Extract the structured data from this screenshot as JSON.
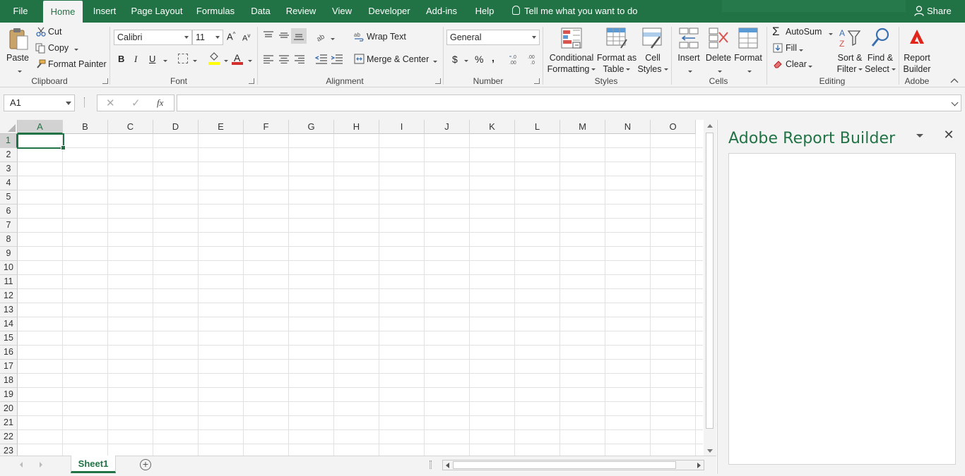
{
  "menu": {
    "tabs": [
      "File",
      "Home",
      "Insert",
      "Page Layout",
      "Formulas",
      "Data",
      "Review",
      "View",
      "Developer",
      "Add-ins",
      "Help"
    ],
    "tell_me": "Tell me what you want to do",
    "share": "Share"
  },
  "ribbon": {
    "clipboard": {
      "paste": "Paste",
      "cut": "Cut",
      "copy": "Copy",
      "format_painter": "Format Painter",
      "label": "Clipboard"
    },
    "font": {
      "name": "Calibri",
      "size": "11",
      "bold": "B",
      "italic": "I",
      "underline": "U",
      "label": "Font",
      "font_color": "#d32f2f",
      "highlight_color": "#ffff00"
    },
    "alignment": {
      "wrap_text": "Wrap Text",
      "merge_center": "Merge & Center",
      "label": "Alignment"
    },
    "number": {
      "format": "General",
      "currency": "$",
      "percent": "%",
      "comma": ",",
      "label": "Number"
    },
    "styles": {
      "conditional": [
        "Conditional",
        "Formatting"
      ],
      "format_table": [
        "Format as",
        "Table"
      ],
      "cell_styles": [
        "Cell",
        "Styles"
      ],
      "label": "Styles"
    },
    "cells": {
      "insert": "Insert",
      "delete": "Delete",
      "format": "Format",
      "label": "Cells"
    },
    "editing": {
      "autosum": "AutoSum",
      "fill": "Fill",
      "clear": "Clear",
      "sort_filter": [
        "Sort &",
        "Filter"
      ],
      "find_select": [
        "Find &",
        "Select"
      ],
      "label": "Editing"
    },
    "adobe": {
      "report_builder": [
        "Report",
        "Builder"
      ],
      "label": "Adobe"
    }
  },
  "formula_bar": {
    "name_box": "A1",
    "fx": "fx",
    "value": ""
  },
  "grid": {
    "columns": [
      "A",
      "B",
      "C",
      "D",
      "E",
      "F",
      "G",
      "H",
      "I",
      "J",
      "K",
      "L",
      "M",
      "N",
      "O"
    ],
    "rows": [
      "1",
      "2",
      "3",
      "4",
      "5",
      "6",
      "7",
      "8",
      "9",
      "10",
      "11",
      "12",
      "13",
      "14",
      "15",
      "16",
      "17",
      "18",
      "19",
      "20",
      "21",
      "22",
      "23"
    ],
    "active_column": "A",
    "active_row": "1"
  },
  "sheets": {
    "tabs": [
      "Sheet1"
    ],
    "add": "+"
  },
  "task_pane": {
    "title": "Adobe Report Builder",
    "close": "✕"
  },
  "colors": {
    "accent": "#217346",
    "adobe_red": "#e1251b"
  }
}
